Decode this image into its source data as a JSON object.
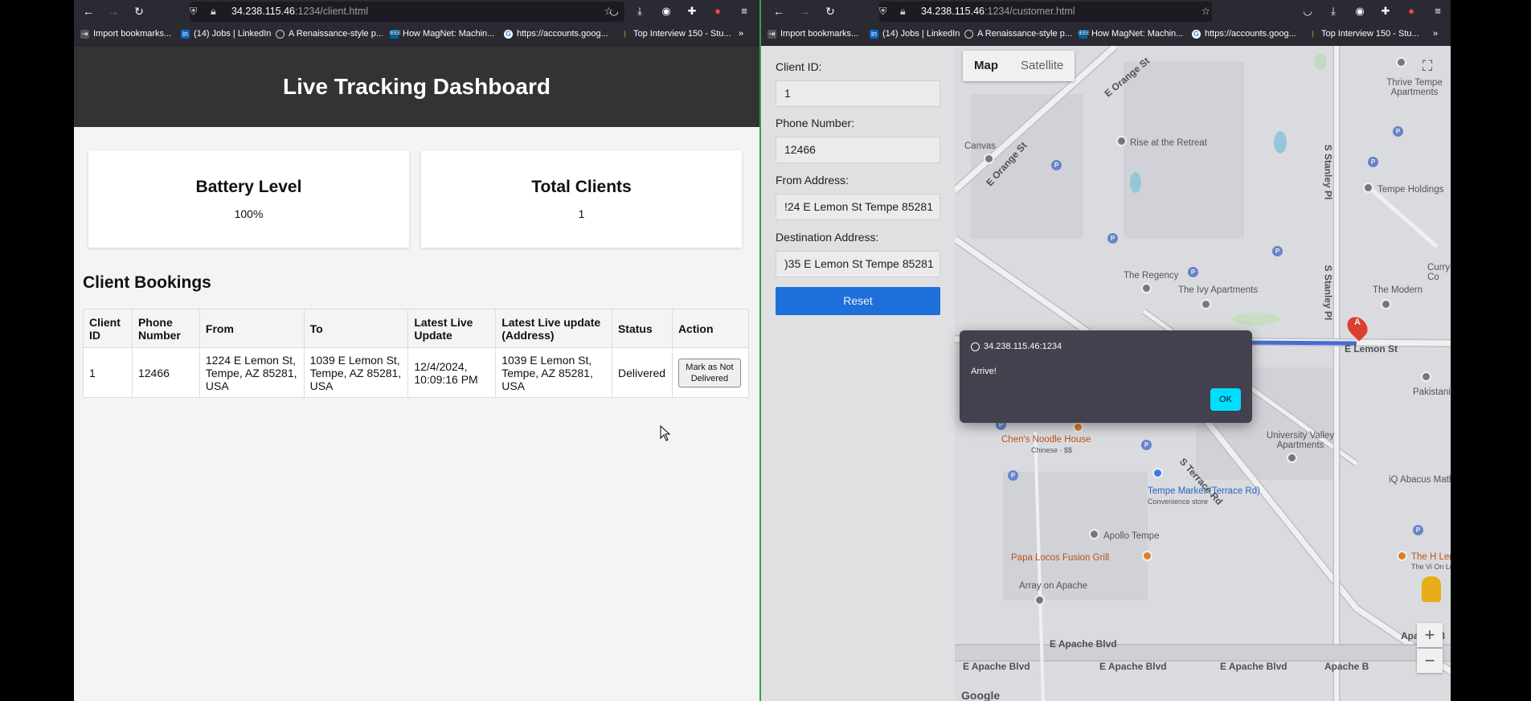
{
  "left_window": {
    "url_host": "34.238.115.46",
    "url_path": ":1234/client.html",
    "bookmarks": [
      "Import bookmarks...",
      "(14) Jobs | LinkedIn",
      "A Renaissance-style p...",
      "How MagNet: Machin...",
      "https://accounts.goog...",
      "Top Interview 150 - Stu..."
    ],
    "page": {
      "title": "Live Tracking Dashboard",
      "cards": [
        {
          "title": "Battery Level",
          "value": "100%"
        },
        {
          "title": "Total Clients",
          "value": "1"
        }
      ],
      "section_title": "Client Bookings",
      "table": {
        "headers": [
          "Client ID",
          "Phone Number",
          "From",
          "To",
          "Latest Live Update",
          "Latest Live update (Address)",
          "Status",
          "Action"
        ],
        "rows": [
          {
            "client_id": "1",
            "phone": "12466",
            "from": "1224 E Lemon St, Tempe, AZ 85281, USA",
            "to": "1039 E Lemon St, Tempe, AZ 85281, USA",
            "latest_update": "12/4/2024, 10:09:16 PM",
            "latest_address": "1039 E Lemon St, Tempe, AZ 85281, USA",
            "status": "Delivered",
            "action": "Mark as Not Delivered"
          }
        ]
      }
    }
  },
  "right_window": {
    "url_host": "34.238.115.46",
    "url_path": ":1234/customer.html",
    "bookmarks": [
      "Import bookmarks...",
      "(14) Jobs | LinkedIn",
      "A Renaissance-style p...",
      "How MagNet: Machin...",
      "https://accounts.goog...",
      "Top Interview 150 - Stu..."
    ],
    "form": {
      "client_id_label": "Client ID:",
      "client_id_value": "1",
      "phone_label": "Phone Number:",
      "phone_value": "12466",
      "from_label": "From Address:",
      "from_value": "!24 E Lemon St Tempe 85281",
      "dest_label": "Destination Address:",
      "dest_value": ")35 E Lemon St Tempe 85281",
      "reset_label": "Reset"
    },
    "map": {
      "toggle_map": "Map",
      "toggle_satellite": "Satellite",
      "places": [
        "Rise at the Retreat",
        "Canvas",
        "Thrive Tempe Apartments",
        "Tempe Holdings",
        "The Regency",
        "The Ivy Apartments",
        "The Modern",
        "Tempe Market (Terrace Rd)",
        "Convenience store",
        "Chen's Noodle House",
        "Chinese · $$",
        "University Valley Apartments",
        "iQ Abacus Math S",
        "Apollo Tempe",
        "Papa Locos Fusion Grill",
        "Array on Apache",
        "The H Lemo",
        "The Vi On Lemo",
        "Curry Co",
        "Pakistani"
      ],
      "streets": [
        "E Orange St",
        "E Lemon St",
        "E Apache Blvd",
        "S Stanley Pl",
        "S Terrace Rd",
        "Apache B"
      ],
      "marker": "A",
      "zoom_in": "+",
      "zoom_out": "−"
    },
    "alert": {
      "origin": "34.238.115.46:1234",
      "message": "Arrive!",
      "ok": "OK"
    }
  }
}
